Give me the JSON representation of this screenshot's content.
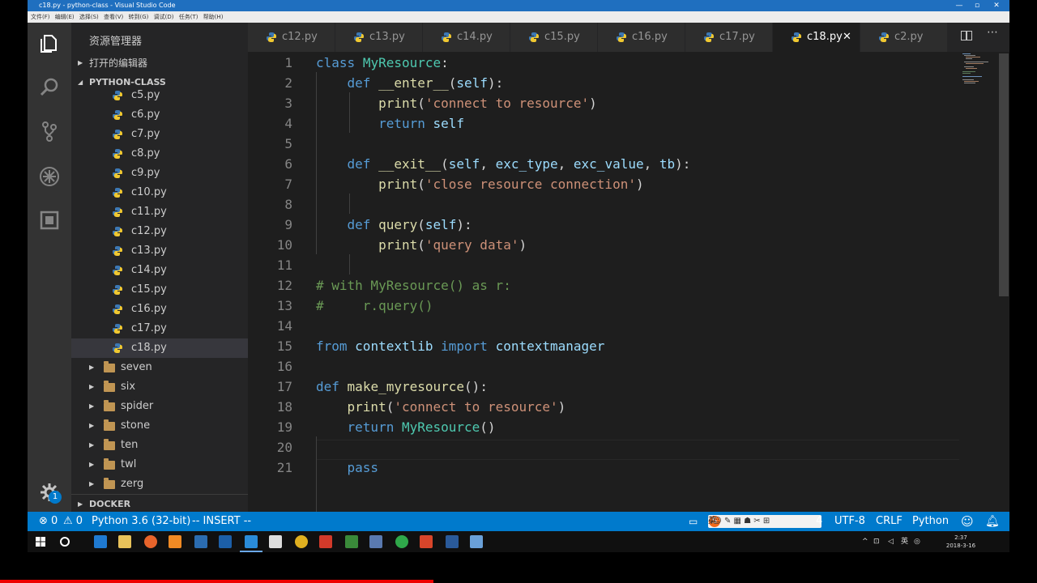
{
  "window": {
    "title": "c18.py - python-class - Visual Studio Code",
    "controls": [
      "—",
      "▫",
      "✕"
    ]
  },
  "menu": [
    "文件(F)",
    "编辑(E)",
    "选择(S)",
    "查看(V)",
    "转到(G)",
    "调试(D)",
    "任务(T)",
    "帮助(H)"
  ],
  "sidebar": {
    "title": "资源管理器",
    "open_editors": "打开的编辑器",
    "project": "PYTHON-CLASS",
    "files": [
      "c5.py",
      "c6.py",
      "c7.py",
      "c8.py",
      "c9.py",
      "c10.py",
      "c11.py",
      "c12.py",
      "c13.py",
      "c14.py",
      "c15.py",
      "c16.py",
      "c17.py",
      "c18.py"
    ],
    "selected_file": "c18.py",
    "folders": [
      "seven",
      "six",
      "spider",
      "stone",
      "ten",
      "twl",
      "zerg"
    ],
    "docker": "DOCKER"
  },
  "tabs": [
    {
      "label": "c12.py"
    },
    {
      "label": "c13.py"
    },
    {
      "label": "c14.py"
    },
    {
      "label": "c15.py"
    },
    {
      "label": "c16.py"
    },
    {
      "label": "c17.py"
    },
    {
      "label": "c18.py",
      "active": true
    },
    {
      "label": "c2.py"
    }
  ],
  "tab_close": "✕",
  "editor": {
    "line_numbers": [
      "1",
      "2",
      "3",
      "4",
      "5",
      "6",
      "7",
      "8",
      "9",
      "10",
      "11",
      "12",
      "13",
      "14",
      "15",
      "16",
      "17",
      "18",
      "19",
      "20",
      "21"
    ],
    "lines": [
      "class MyResource:",
      "    def __enter__(self):",
      "        print('connect to resource')",
      "        return self",
      "",
      "    def __exit__(self, exc_type, exc_value, tb):",
      "        print('close resource connection')",
      "",
      "    def query(self):",
      "        print('query data')",
      "",
      "# with MyResource() as r:",
      "#     r.query()",
      "",
      "from contextlib import contextmanager",
      "",
      "def make_myresource():",
      "    print('connect to resource')",
      "    return MyResource()",
      "",
      "    pass"
    ]
  },
  "status": {
    "errors": "0",
    "warnings": "0",
    "interpreter": "Python 3.6 (32-bit)",
    "mode": "-- INSERT --",
    "ime": "英",
    "ime_tail": "4",
    "encoding": "UTF-8",
    "eol": "CRLF",
    "language": "Python",
    "notifications": "1"
  },
  "taskbar": {
    "tray_ime": "英",
    "time": "2:37",
    "date": "2018-3-16"
  },
  "colors": {
    "status": "#007acc",
    "accent_red": "#e00000"
  }
}
